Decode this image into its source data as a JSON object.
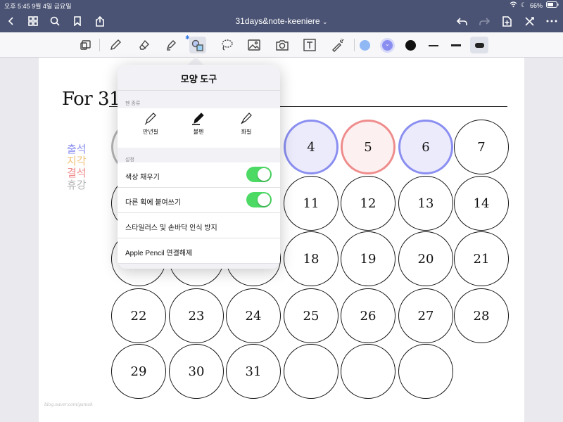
{
  "status": {
    "time_date": "오후 5:45   9월 4일 금요일",
    "battery": "66%"
  },
  "nav": {
    "title": "31days&note-keeniere",
    "chevron": "⌄"
  },
  "page": {
    "title": "For 31 d",
    "watermark": "blog.naver.com/gamoh"
  },
  "legend": [
    {
      "label": "출석",
      "color": "#8a8ef0"
    },
    {
      "label": "지각",
      "color": "#f1c27a"
    },
    {
      "label": "결석",
      "color": "#ef8c8c"
    },
    {
      "label": "휴강",
      "color": "#b5b5b5"
    }
  ],
  "toolbar": {
    "colors": [
      "#8fb8f5",
      "#8a8ef0",
      "#111111"
    ]
  },
  "calendar": {
    "days": [
      {
        "n": "4",
        "state": "blue"
      },
      {
        "n": "5",
        "state": "red"
      },
      {
        "n": "6",
        "state": "blue"
      },
      {
        "n": "7",
        "state": ""
      },
      {
        "n": "11",
        "state": ""
      },
      {
        "n": "12",
        "state": ""
      },
      {
        "n": "13",
        "state": ""
      },
      {
        "n": "14",
        "state": ""
      },
      {
        "n": "18",
        "state": ""
      },
      {
        "n": "19",
        "state": ""
      },
      {
        "n": "20",
        "state": ""
      },
      {
        "n": "21",
        "state": ""
      },
      {
        "n": "22",
        "state": ""
      },
      {
        "n": "23",
        "state": ""
      },
      {
        "n": "24",
        "state": ""
      },
      {
        "n": "25",
        "state": ""
      },
      {
        "n": "26",
        "state": ""
      },
      {
        "n": "27",
        "state": ""
      },
      {
        "n": "28",
        "state": ""
      },
      {
        "n": "29",
        "state": ""
      },
      {
        "n": "30",
        "state": ""
      },
      {
        "n": "31",
        "state": ""
      },
      {
        "n": "",
        "state": ""
      },
      {
        "n": "",
        "state": ""
      },
      {
        "n": "",
        "state": ""
      }
    ]
  },
  "popover": {
    "title": "모양 도구",
    "pen_section": "펜 종류",
    "pens": [
      {
        "label": "만년필"
      },
      {
        "label": "볼펜"
      },
      {
        "label": "화필"
      }
    ],
    "settings_section": "설정",
    "fill_color": "색상 채우기",
    "snap_strokes": "다른 획에 붙여쓰기",
    "palm_rejection": "스타일러스 및 손바닥 인식 방지",
    "disconnect_pencil": "Apple Pencil 연결해제",
    "toggle_fill_on": true,
    "toggle_snap_on": true
  }
}
